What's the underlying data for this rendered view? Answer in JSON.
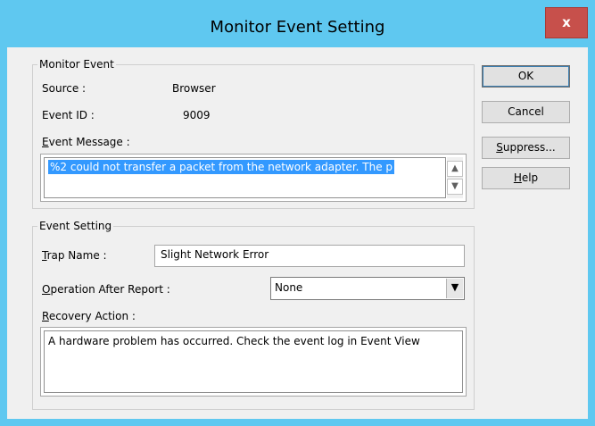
{
  "window": {
    "title": "Monitor Event Setting",
    "close_label": "x"
  },
  "monitor_event": {
    "group_label": "Monitor Event",
    "source_label": "Source   :",
    "source_value": "Browser",
    "event_id_label": "Event ID  :",
    "event_id_value": "9009",
    "message_label_mnemonic": "E",
    "message_label_rest": "vent Message :",
    "message_value": "%2 could not transfer a packet from the network adapter.  The p"
  },
  "event_setting": {
    "group_label": "Event Setting",
    "trap_label_mnemonic": "T",
    "trap_label_rest": "rap Name :",
    "trap_value": "Slight Network Error",
    "operation_label_mnemonic": "O",
    "operation_label_rest": "peration After Report :",
    "operation_value": "None",
    "recovery_label_mnemonic": "R",
    "recovery_label_rest": "ecovery Action :",
    "recovery_value": "A hardware problem has occurred. Check the event log in Event View"
  },
  "buttons": {
    "ok": "OK",
    "cancel": "Cancel",
    "suppress_mnemonic": "S",
    "suppress_rest": "uppress...",
    "help_mnemonic": "H",
    "help_rest": "elp"
  },
  "icons": {
    "scroll_up": "up-arrow",
    "scroll_down": "down-arrow",
    "dropdown": "down-triangle"
  }
}
